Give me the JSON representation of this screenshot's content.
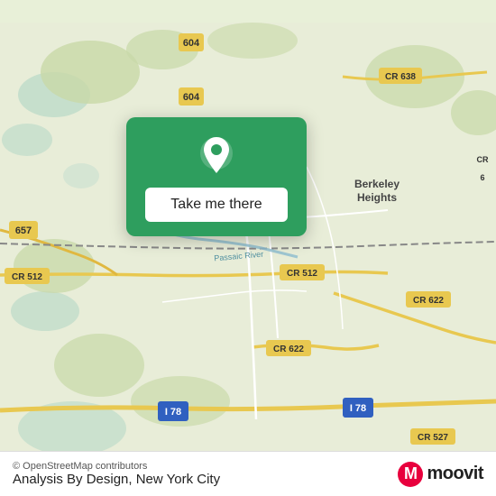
{
  "map": {
    "background_color": "#e8f0d8",
    "alt": "Map of New Jersey area near Berkeley Heights"
  },
  "popup": {
    "button_label": "Take me there",
    "pin_color": "#ffffff"
  },
  "bottom_bar": {
    "osm_credit": "© OpenStreetMap contributors",
    "location_title": "Analysis By Design, New York City",
    "moovit_m": "M",
    "moovit_text": "moovit"
  },
  "road_labels": {
    "cr604_top": "604",
    "cr604_mid": "604",
    "cr638": "CR 638",
    "cr657": "657",
    "cr512_left": "CR 512",
    "cr512_right": "CR 512",
    "cr622_right": "CR 622",
    "cr622_bottom": "CR 622",
    "i78_left": "I 78",
    "i78_right": "I 78",
    "cr527": "CR 527",
    "berkeley_heights": "Berkeley Heights"
  }
}
